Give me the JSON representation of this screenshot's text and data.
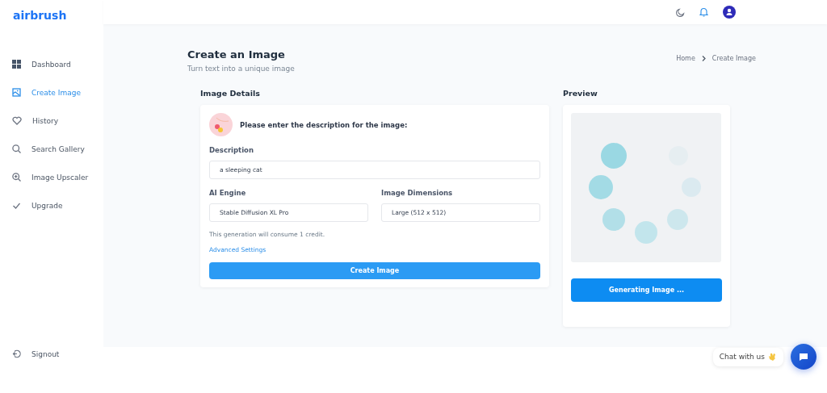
{
  "logo": "airbrush",
  "sidebar": {
    "items": [
      {
        "label": "Dashboard",
        "selected": false
      },
      {
        "label": "Create Image",
        "selected": true
      },
      {
        "label": "History",
        "selected": false
      },
      {
        "label": "Search Gallery",
        "selected": false
      },
      {
        "label": "Image Upscaler",
        "selected": false
      },
      {
        "label": "Upgrade",
        "selected": false
      }
    ],
    "footer_item": {
      "label": "Signout"
    }
  },
  "page": {
    "title": "Create an Image",
    "subtitle": "Turn text into a unique image",
    "breadcrumb": [
      "Home",
      "Create Image"
    ]
  },
  "form": {
    "heading": "Image Details",
    "prompt": "Please enter the description for the image:",
    "fields": [
      {
        "label": "Description",
        "value": "a sleeping cat"
      },
      {
        "label": "AI Engine",
        "value": "Stable Diffusion XL Pro"
      },
      {
        "label": "Image Dimensions",
        "value": "Large (512 x 512)"
      }
    ],
    "note": "This generation will consume 1 credit.",
    "link": "Advanced Settings",
    "button": "Create Image"
  },
  "preview": {
    "heading": "Preview",
    "button": "Generating Image ..."
  },
  "chat": {
    "label": "Chat with us"
  }
}
